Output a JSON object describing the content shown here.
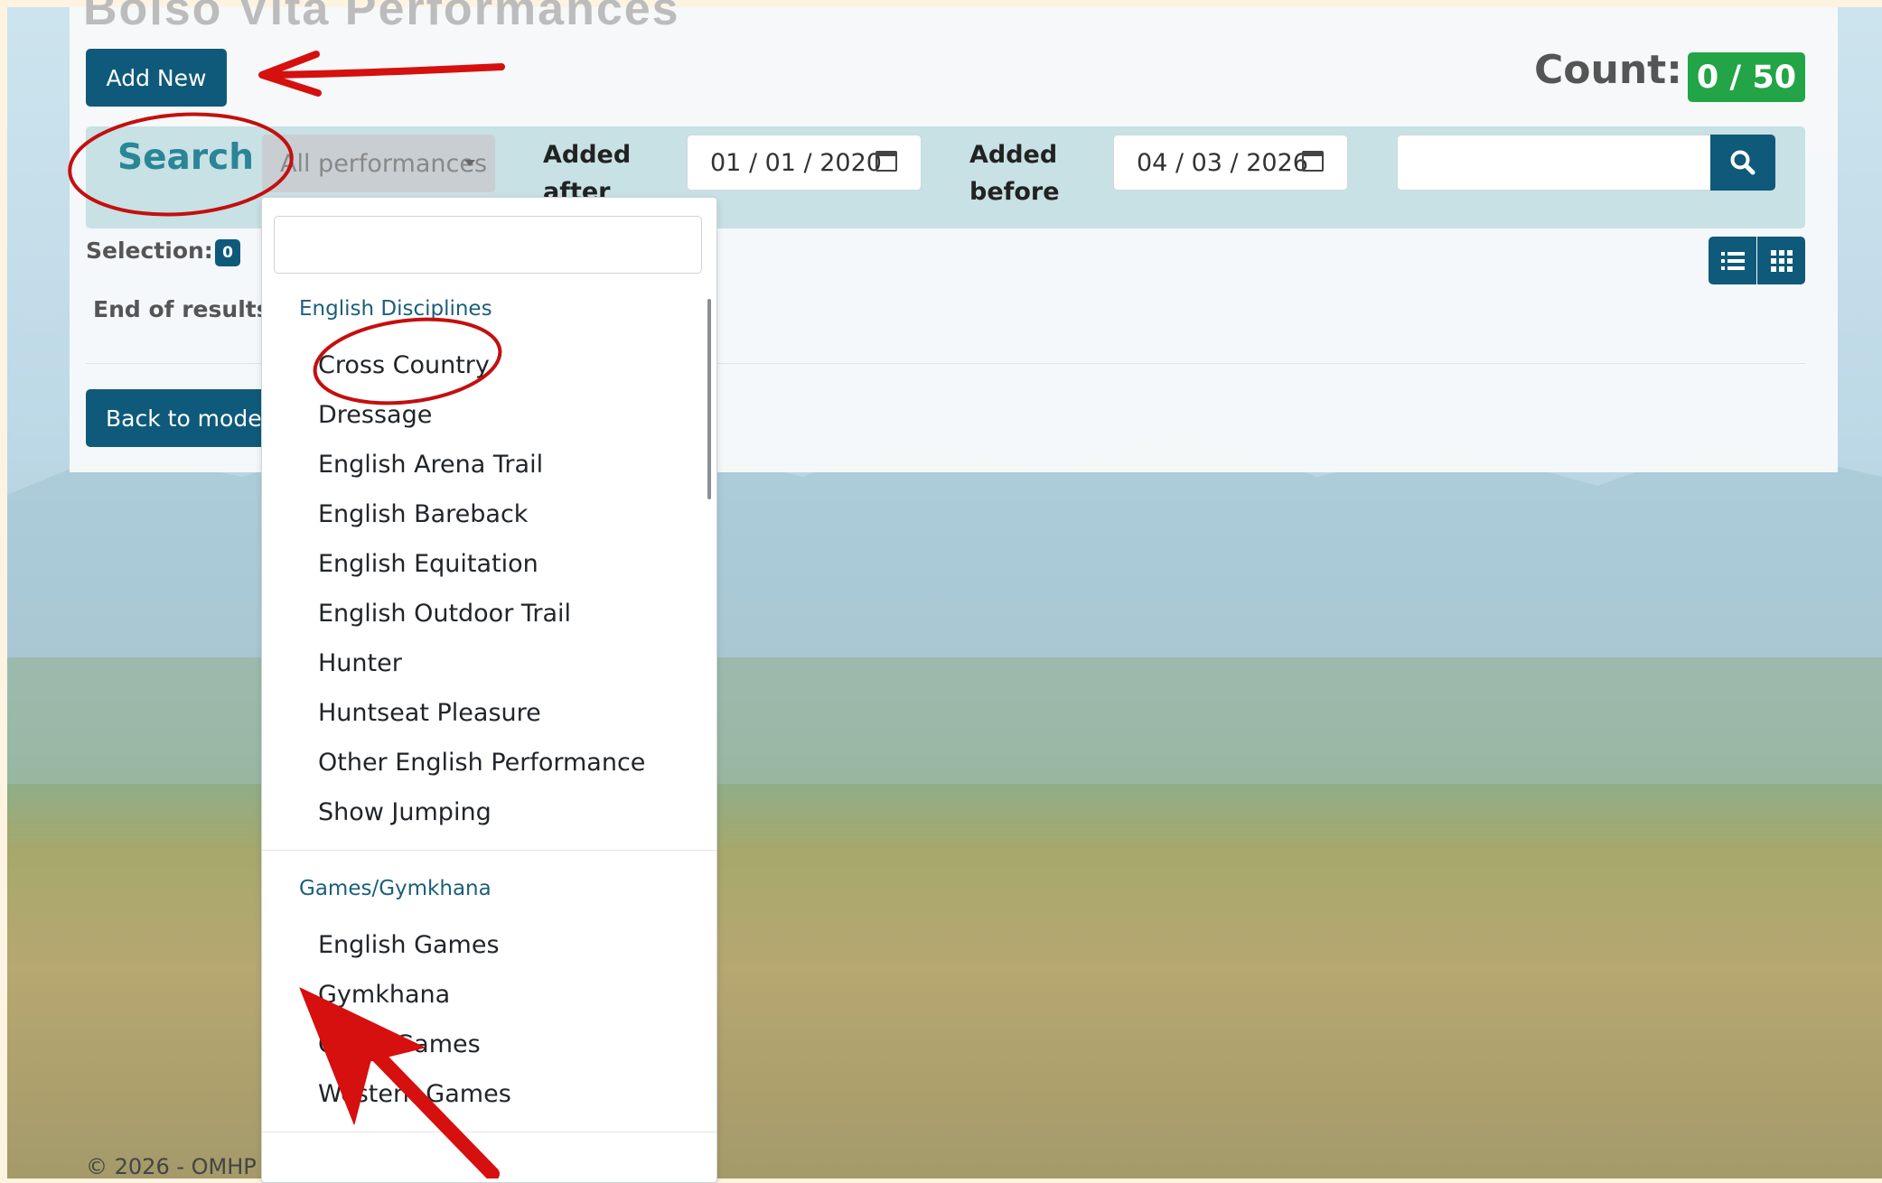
{
  "page": {
    "title": "Bolso Vita Performances"
  },
  "toolbar": {
    "add_new": "Add New",
    "count_label": "Count:",
    "count_value": "0 / 50"
  },
  "search": {
    "title": "Search",
    "filter_selected": "All performances",
    "added_after_label_1": "Added",
    "added_after_label_2": "after",
    "added_after_value": "01 / 01 / 2020",
    "added_before_label_1": "Added",
    "added_before_label_2": "before",
    "added_before_value": "04 / 03 / 2026",
    "text_value": ""
  },
  "selection": {
    "label": "Selection:",
    "count": "0"
  },
  "results": {
    "end_text": "End of results",
    "back_button": "Back to models"
  },
  "footer": {
    "copyright": "© 2026 - OMHP"
  },
  "dropdown": {
    "search_value": "",
    "groups": [
      {
        "label": "English Disciplines",
        "options": [
          "Cross Country",
          "Dressage",
          "English Arena Trail",
          "English Bareback",
          "English Equitation",
          "English Outdoor Trail",
          "Hunter",
          "Huntseat Pleasure",
          "Other English Performance",
          "Show Jumping"
        ]
      },
      {
        "label": "Games/Gymkhana",
        "options": [
          "English Games",
          "Gymkhana",
          "Other Games",
          "Western Games"
        ]
      }
    ]
  },
  "colors": {
    "primary": "#0f5a7a",
    "count_badge": "#23a447",
    "search_title": "#2a8597",
    "annotation": "#d60f0f"
  },
  "icons": [
    "search-icon",
    "calendar-icon",
    "list-view-icon",
    "grid-view-icon",
    "caret-down-icon"
  ]
}
